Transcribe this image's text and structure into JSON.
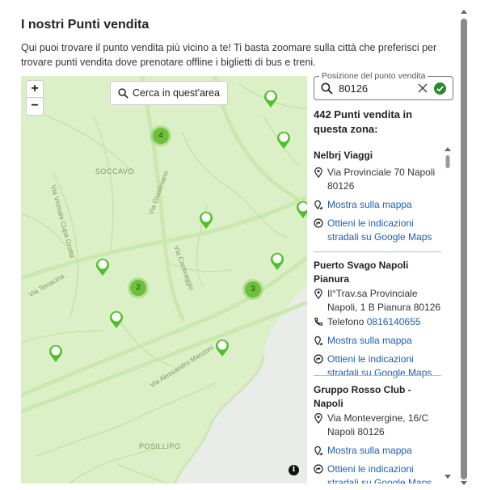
{
  "dialog": {
    "title": "I nostri Punti vendita",
    "intro": "Qui puoi trovare il punto vendita più vicino a te! Ti basta zoomare sulla città che preferisci per trovare punti vendita dove prenotare offline i biglietti di bus e treni."
  },
  "map": {
    "zoom_in": "+",
    "zoom_out": "−",
    "search_area_label": "Cerca in quest'area",
    "district_labels": [
      "SOCCAVO",
      "POSILLIPO"
    ],
    "road_labels": [
      "Via Vicinale Cupa Grotta",
      "Via Terracina",
      "Via Giustiniano",
      "Via Caravaggio",
      "Via Alessandro Manzoni"
    ],
    "clusters": [
      "4",
      "2",
      "3"
    ],
    "info_label": "i",
    "pin_color": "#4fbf2a",
    "land_color": "#dcf0c8",
    "sea_color": "#e9ece9"
  },
  "panel": {
    "field_label": "Posizione del punto vendita",
    "field_value": "80126",
    "result_count": "442 Punti vendita in questa zona:",
    "link_color": "#1a5fb4",
    "stores": [
      {
        "name": "Nelbrj Viaggi",
        "address": "Via Provinciale 70 Napoli 80126",
        "phone_label": "",
        "phone": "",
        "map_link": "Mostra sulla mappa",
        "directions_link": "Ottieni le indicazioni stradali su Google Maps"
      },
      {
        "name": "Puerto Svago Napoli Pianura",
        "address": "Il°Trav.sa Provinciale Napoli, 1 B Pianura 80126",
        "phone_label": "Telefono",
        "phone": "0816140655",
        "map_link": "Mostra sulla mappa",
        "directions_link": "Ottieni le indicazioni stradali su Google Maps"
      },
      {
        "name": "Gruppo Rosso Club - Napoli",
        "address": "Via Montevergine, 16/C Napoli 80126",
        "phone_label": "",
        "phone": "",
        "map_link": "Mostra sulla mappa",
        "directions_link": "Ottieni le indicazioni stradali su Google Maps"
      }
    ]
  }
}
